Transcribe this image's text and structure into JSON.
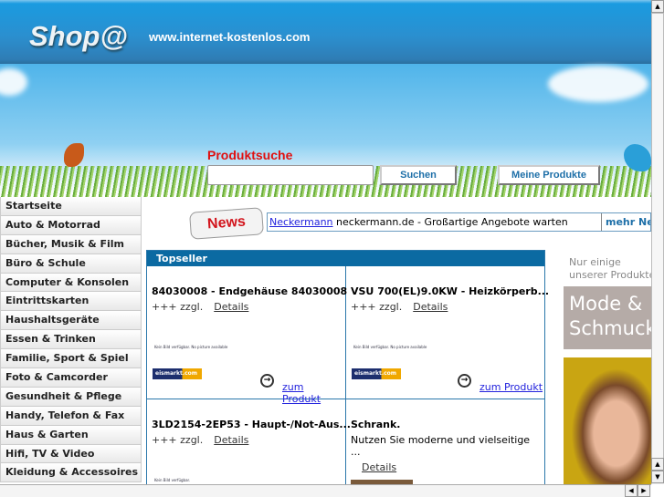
{
  "header": {
    "logo": "Shop@",
    "url": "www.internet-kostenlos.com"
  },
  "search": {
    "title": "Produktsuche",
    "value": "",
    "button": "Suchen",
    "my_products": "Meine Produkte"
  },
  "sidebar": {
    "items": [
      "Startseite",
      "Auto & Motorrad",
      "Bücher, Musik & Film",
      "Büro & Schule",
      "Computer & Konsolen",
      "Eintrittskarten",
      "Haushaltsgeräte",
      "Essen & Trinken",
      "Familie, Sport & Spiel",
      "Foto & Camcorder",
      "Gesundheit & Pflege",
      "Handy, Telefon & Fax",
      "Haus & Garten",
      "Hifi, TV & Video",
      "Kleidung & Accessoires"
    ]
  },
  "news": {
    "badge": "News",
    "link": "Neckermann",
    "text": " neckermann.de - Großartige Angebote warten",
    "more": "mehr News"
  },
  "topseller": {
    "title": "Topseller",
    "products": [
      {
        "title": "84030008 - Endgehäuse 84030008",
        "price": "+++ zzgl.",
        "details": "Details",
        "noimage": "Kein Bild verfügbar. No picture available",
        "shop": "eismarkt.com",
        "link": "zum Produkt"
      },
      {
        "title": "VSU 700(EL)9.0KW - Heizkörperb...",
        "price": "+++ zzgl.",
        "details": "Details",
        "noimage": "Kein Bild verfügbar. No picture available",
        "shop": "eismarkt.com",
        "link": "zum Produkt"
      },
      {
        "title": "3LD2154-2EP53 - Haupt-/Not-Aus...",
        "price": "+++ zzgl.",
        "details": "Details",
        "noimage": "Kein Bild verfügbar."
      },
      {
        "title": "Schrank.",
        "desc": "Nutzen Sie moderne und vielseitige ...",
        "details": "Details"
      }
    ]
  },
  "promo": {
    "line1": "Nur einige",
    "line2": "unserer Produkte",
    "banner1": "Mode &",
    "banner2": "Schmuck"
  }
}
